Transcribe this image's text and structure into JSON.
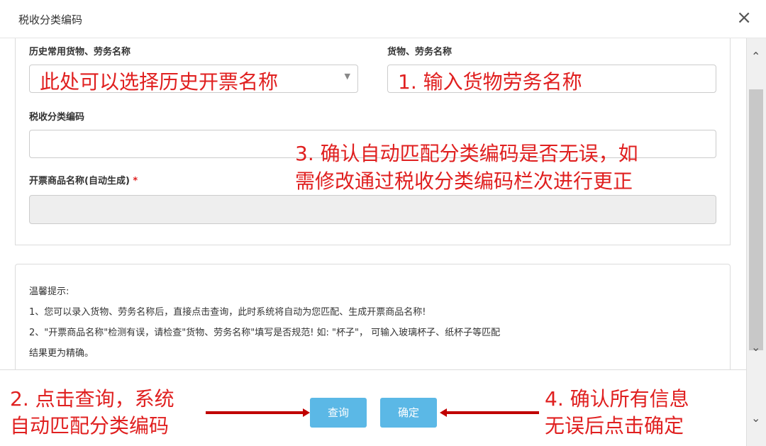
{
  "dialog": {
    "title": "税收分类编码",
    "close_glyph": "×"
  },
  "form": {
    "history_label": "历史常用货物、劳务名称",
    "history_select_value": "此处可以选择历史开票名称",
    "goods_label": "货物、劳务名称",
    "goods_input_value": "1. 输入货物劳务名称",
    "tax_code_label": "税收分类编码",
    "tax_code_value": "",
    "product_name_label": "开票商品名称(自动生成)",
    "required_mark": "*",
    "product_name_value": ""
  },
  "annotations": {
    "step3_line1": "3. 确认自动匹配分类编码是否无误，如",
    "step3_line2": "需修改通过税收分类编码栏次进行更正",
    "step2_line1": "2. 点击查询，系统",
    "step2_line2": "自动匹配分类编码",
    "step4_line1": "4. 确认所有信息",
    "step4_line2": "无误后点击确定",
    "color": "#e02020"
  },
  "tips": {
    "title": "温馨提示:",
    "line1": "1、您可以录入货物、劳务名称后，直接点击查询，此时系统将自动为您匹配、生成开票商品名称!",
    "line2": "2、\"开票商品名称\"检测有误，请检查\"货物、劳务名称\"填写是否规范! 如: \"杯子\"， 可输入玻璃杯子、纸杯子等匹配",
    "line3": "结果更为精确。"
  },
  "footer": {
    "query_label": "查询",
    "confirm_label": "确定",
    "button_color": "#5bb8e6"
  },
  "scrollbar": {
    "up_glyph": "⌃",
    "down_glyph": "⌄"
  }
}
